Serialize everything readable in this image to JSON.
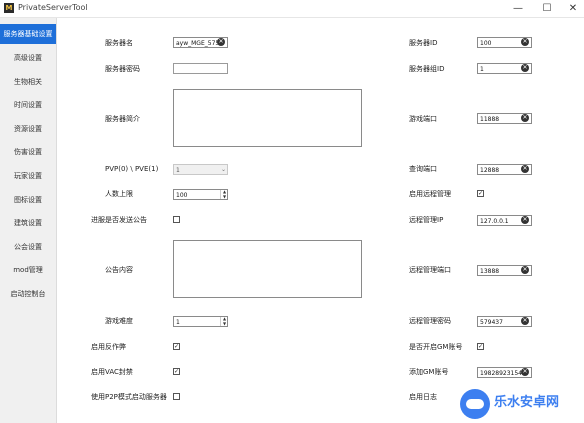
{
  "window": {
    "app_icon_glyph": "M",
    "title": "PrivateServerTool",
    "minimize_glyph": "—",
    "maximize_glyph": "☐",
    "close_glyph": "✕"
  },
  "sidebar": {
    "items": [
      {
        "label": "服务器基础设置"
      },
      {
        "label": "高级设置"
      },
      {
        "label": "生物相关"
      },
      {
        "label": "时间设置"
      },
      {
        "label": "资源设置"
      },
      {
        "label": "伤害设置"
      },
      {
        "label": "玩家设置"
      },
      {
        "label": "图标设置"
      },
      {
        "label": "建筑设置"
      },
      {
        "label": "公会设置"
      },
      {
        "label": "mod管理"
      },
      {
        "label": "启动控制台"
      }
    ],
    "active_index": 0
  },
  "form": {
    "server_name": {
      "label": "服务器名",
      "value": "ayw_MGE_5750"
    },
    "server_password": {
      "label": "服务器密码",
      "value": ""
    },
    "server_intro": {
      "label": "服务器简介",
      "value": ""
    },
    "pvp": {
      "label": "PVP(0) \\ PVE(1)",
      "value": "1"
    },
    "max_players": {
      "label": "人数上限",
      "value": "100"
    },
    "broadcast_enabled": {
      "label": "进服是否发送公告",
      "checked": false
    },
    "announcement": {
      "label": "公告内容",
      "value": ""
    },
    "difficulty": {
      "label": "游戏难度",
      "value": "1"
    },
    "anti_cheat": {
      "label": "启用反作弊",
      "checked": true
    },
    "vac_ban": {
      "label": "启用VAC封禁",
      "checked": true
    },
    "p2p_mode": {
      "label": "使用P2P模式启动服务器",
      "checked": false
    },
    "server_id": {
      "label": "服务器ID",
      "value": "100"
    },
    "server_group_id": {
      "label": "服务器组ID",
      "value": "1"
    },
    "game_port": {
      "label": "游戏端口",
      "value": "11888"
    },
    "query_port": {
      "label": "查询端口",
      "value": "12888"
    },
    "remote_admin": {
      "label": "启用远程管理",
      "checked": true
    },
    "remote_ip": {
      "label": "远程管理IP",
      "value": "127.0.0.1"
    },
    "remote_port": {
      "label": "远程管理端口",
      "value": "13888"
    },
    "remote_password": {
      "label": "远程管理密码",
      "value": "579437"
    },
    "gm_account_enabled": {
      "label": "是否开启GM账号",
      "checked": true
    },
    "add_gm_account": {
      "label": "添加GM账号",
      "value": "198289231546"
    },
    "server_log": {
      "label": "启用日志",
      "checked": false
    }
  },
  "icons": {
    "clear": "✕",
    "spin_up": "▲",
    "spin_down": "▼",
    "dropdown": "⌄",
    "check": "✓"
  },
  "watermark": {
    "text": "乐水安卓网",
    "accent": "#3d7ff0"
  },
  "colors": {
    "sidebar_active": "#1e6fd9",
    "sidebar_bg": "#f0f0f0"
  }
}
